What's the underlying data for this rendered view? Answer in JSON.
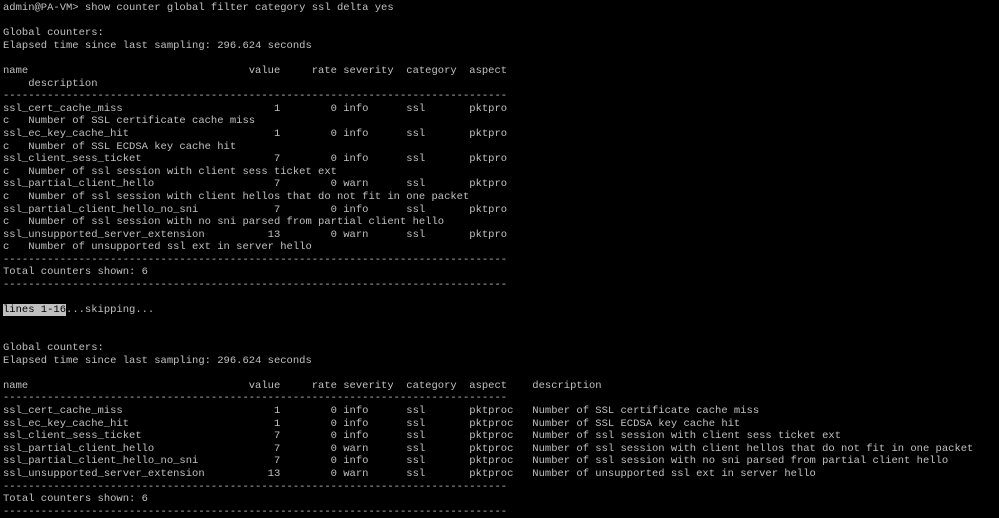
{
  "terminal": {
    "lines": [
      "admin@PA-VM> show counter global filter category ssl delta yes",
      "",
      "Global counters:",
      "Elapsed time since last sampling: 296.624 seconds",
      "",
      "name                                   value     rate severity  category  aspect",
      "    description",
      "--------------------------------------------------------------------------------",
      "ssl_cert_cache_miss                        1        0 info      ssl       pktpro",
      "c   Number of SSL certificate cache miss",
      "ssl_ec_key_cache_hit                       1        0 info      ssl       pktpro",
      "c   Number of SSL ECDSA key cache hit",
      "ssl_client_sess_ticket                     7        0 info      ssl       pktpro",
      "c   Number of ssl session with client sess ticket ext",
      "ssl_partial_client_hello                   7        0 warn      ssl       pktpro",
      "c   Number of ssl session with client hellos that do not fit in one packet",
      "ssl_partial_client_hello_no_sni            7        0 info      ssl       pktpro",
      "c   Number of ssl session with no sni parsed from partial client hello",
      "ssl_unsupported_server_extension          13        0 warn      ssl       pktpro",
      "c   Number of unsupported ssl ext in server hello",
      "--------------------------------------------------------------------------------",
      "Total counters shown: 6",
      "--------------------------------------------------------------------------------",
      "",
      "",
      "",
      "Global counters:",
      "Elapsed time since last sampling: 296.624 seconds",
      "",
      "name                                   value     rate severity  category  aspect    description",
      "--------------------------------------------------------------------------------",
      "ssl_cert_cache_miss                        1        0 info      ssl       pktproc   Number of SSL certificate cache miss",
      "ssl_ec_key_cache_hit                       1        0 info      ssl       pktproc   Number of SSL ECDSA key cache hit",
      "ssl_client_sess_ticket                     7        0 info      ssl       pktproc   Number of ssl session with client sess ticket ext",
      "ssl_partial_client_hello                   7        0 warn      ssl       pktproc   Number of ssl session with client hellos that do not fit in one packet",
      "ssl_partial_client_hello_no_sni            7        0 info      ssl       pktproc   Number of ssl session with no sni parsed from partial client hello",
      "ssl_unsupported_server_extension          13        0 warn      ssl       pktproc   Number of unsupported ssl ext in server hello",
      "--------------------------------------------------------------------------------",
      "Total counters shown: 6",
      "--------------------------------------------------------------------------------"
    ],
    "pager": {
      "highlight": "lines 1-16",
      "rest": "...skipping..."
    }
  }
}
